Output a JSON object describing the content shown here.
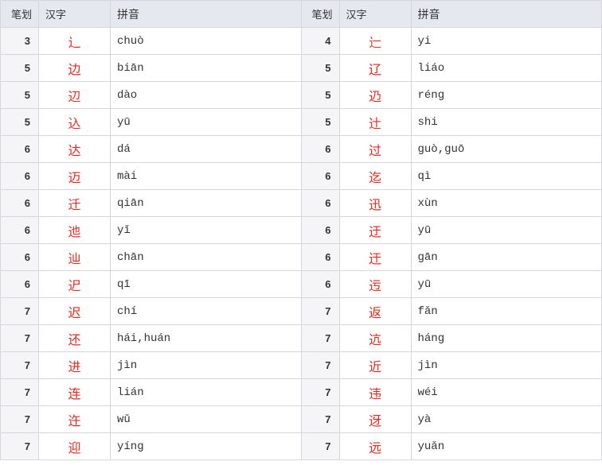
{
  "headers": {
    "strokes": "笔划",
    "hanzi": "汉字",
    "pinyin": "拼音"
  },
  "rows": [
    {
      "l": {
        "strokes": "3",
        "hanzi": "辶",
        "pinyin": "chuò"
      },
      "r": {
        "strokes": "4",
        "hanzi": "辷",
        "pinyin": "yi"
      }
    },
    {
      "l": {
        "strokes": "5",
        "hanzi": "边",
        "pinyin": "biān"
      },
      "r": {
        "strokes": "5",
        "hanzi": "辽",
        "pinyin": "liáo"
      }
    },
    {
      "l": {
        "strokes": "5",
        "hanzi": "辺",
        "pinyin": "dào"
      },
      "r": {
        "strokes": "5",
        "hanzi": "辸",
        "pinyin": "réng"
      }
    },
    {
      "l": {
        "strokes": "5",
        "hanzi": "込",
        "pinyin": "yū"
      },
      "r": {
        "strokes": "5",
        "hanzi": "辻",
        "pinyin": "shi"
      }
    },
    {
      "l": {
        "strokes": "6",
        "hanzi": "达",
        "pinyin": "dá"
      },
      "r": {
        "strokes": "6",
        "hanzi": "过",
        "pinyin": "guò,guō"
      }
    },
    {
      "l": {
        "strokes": "6",
        "hanzi": "迈",
        "pinyin": "mài"
      },
      "r": {
        "strokes": "6",
        "hanzi": "迄",
        "pinyin": "qì"
      }
    },
    {
      "l": {
        "strokes": "6",
        "hanzi": "迁",
        "pinyin": "qiān"
      },
      "r": {
        "strokes": "6",
        "hanzi": "迅",
        "pinyin": "xùn"
      }
    },
    {
      "l": {
        "strokes": "6",
        "hanzi": "迆",
        "pinyin": "yǐ"
      },
      "r": {
        "strokes": "6",
        "hanzi": "迂",
        "pinyin": "yū"
      }
    },
    {
      "l": {
        "strokes": "6",
        "hanzi": "辿",
        "pinyin": "chān"
      },
      "r": {
        "strokes": "6",
        "hanzi": "迀",
        "pinyin": "gān"
      }
    },
    {
      "l": {
        "strokes": "6",
        "hanzi": "迉",
        "pinyin": "qī"
      },
      "r": {
        "strokes": "6",
        "hanzi": "迃",
        "pinyin": "yū"
      }
    },
    {
      "l": {
        "strokes": "7",
        "hanzi": "迟",
        "pinyin": "chí"
      },
      "r": {
        "strokes": "7",
        "hanzi": "返",
        "pinyin": "fǎn"
      }
    },
    {
      "l": {
        "strokes": "7",
        "hanzi": "还",
        "pinyin": "hái,huán"
      },
      "r": {
        "strokes": "7",
        "hanzi": "迒",
        "pinyin": "háng"
      }
    },
    {
      "l": {
        "strokes": "7",
        "hanzi": "进",
        "pinyin": "jìn"
      },
      "r": {
        "strokes": "7",
        "hanzi": "近",
        "pinyin": "jìn"
      }
    },
    {
      "l": {
        "strokes": "7",
        "hanzi": "连",
        "pinyin": "lián"
      },
      "r": {
        "strokes": "7",
        "hanzi": "违",
        "pinyin": "wéi"
      }
    },
    {
      "l": {
        "strokes": "7",
        "hanzi": "迕",
        "pinyin": "wǔ"
      },
      "r": {
        "strokes": "7",
        "hanzi": "迓",
        "pinyin": "yà"
      }
    },
    {
      "l": {
        "strokes": "7",
        "hanzi": "迎",
        "pinyin": "yíng"
      },
      "r": {
        "strokes": "7",
        "hanzi": "远",
        "pinyin": "yuǎn"
      }
    }
  ]
}
